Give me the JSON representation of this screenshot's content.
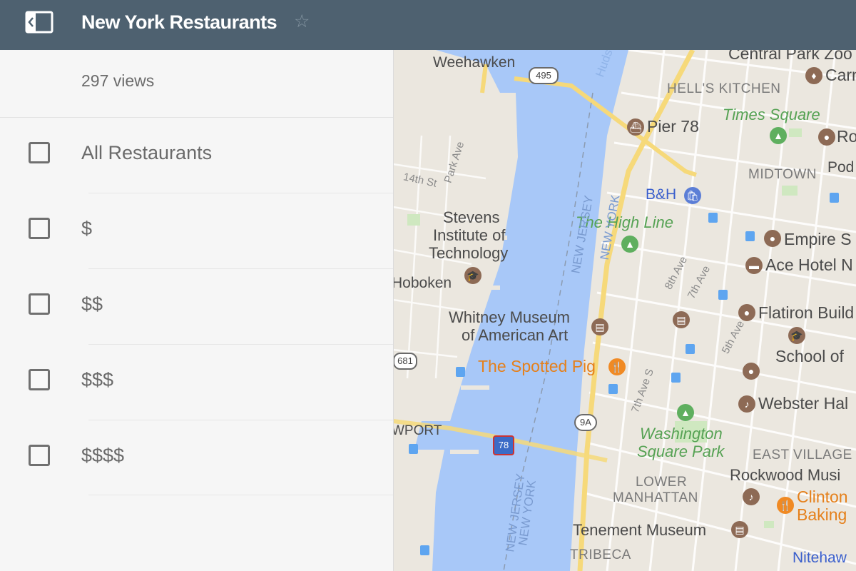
{
  "header": {
    "title": "New York Restaurants",
    "star_icon": "☆"
  },
  "sidebar": {
    "views": "297 views",
    "layers": [
      {
        "label": "All Restaurants",
        "checked": false
      },
      {
        "label": "$",
        "checked": false
      },
      {
        "label": "$$",
        "checked": false
      },
      {
        "label": "$$$",
        "checked": false
      },
      {
        "label": "$$$$",
        "checked": false
      }
    ]
  },
  "map": {
    "labels": {
      "central_park": "Central Park Zoo",
      "carn": "Carn",
      "weehawken": "Weehawken",
      "hudson": "Huds",
      "hells_kitchen": "HELL'S KITCHEN",
      "times_square": "Times Square",
      "pier78": "Pier 78",
      "ro": "Ro",
      "midtown": "MIDTOWN",
      "pod": "Pod",
      "park_ave": "Park Ave",
      "st14": "14th St",
      "bh": "B&H",
      "stevens1": "Stevens",
      "stevens2": "Institute of",
      "stevens3": "Technology",
      "high_line": "The High Line",
      "empire": "Empire S",
      "ace": "Ace Hotel N",
      "hoboken": "Hoboken",
      "ave8": "8th Ave",
      "ave7": "7th Ave",
      "whitney1": "Whitney Museum",
      "whitney2": "of American Art",
      "flatiron": "Flatiron Build",
      "ave5": "5th Ave",
      "school": "School of",
      "spotted_pig": "The Spotted Pig",
      "ave7s": "7th Ave S",
      "webster": "Webster Hal",
      "wport": "WPORT",
      "washington1": "Washington",
      "washington2": "Square Park",
      "east_village": "EAST VILLAGE",
      "lower1": "LOWER",
      "lower2": "MANHATTAN",
      "rockwood": "Rockwood Musi",
      "clinton1": "Clinton",
      "clinton2": "Baking",
      "nj1": "NEW JERSEY",
      "ny1": "NEW YORK",
      "nj2": "NEW JERSEY",
      "ny2": "NEW YORK",
      "tenement": "Tenement Museum",
      "tribeca": "TRIBECA",
      "nitehawk": "Nitehaw"
    },
    "shields": {
      "r495": "495",
      "r681": "681",
      "i78": "78",
      "r9a": "9A"
    }
  }
}
